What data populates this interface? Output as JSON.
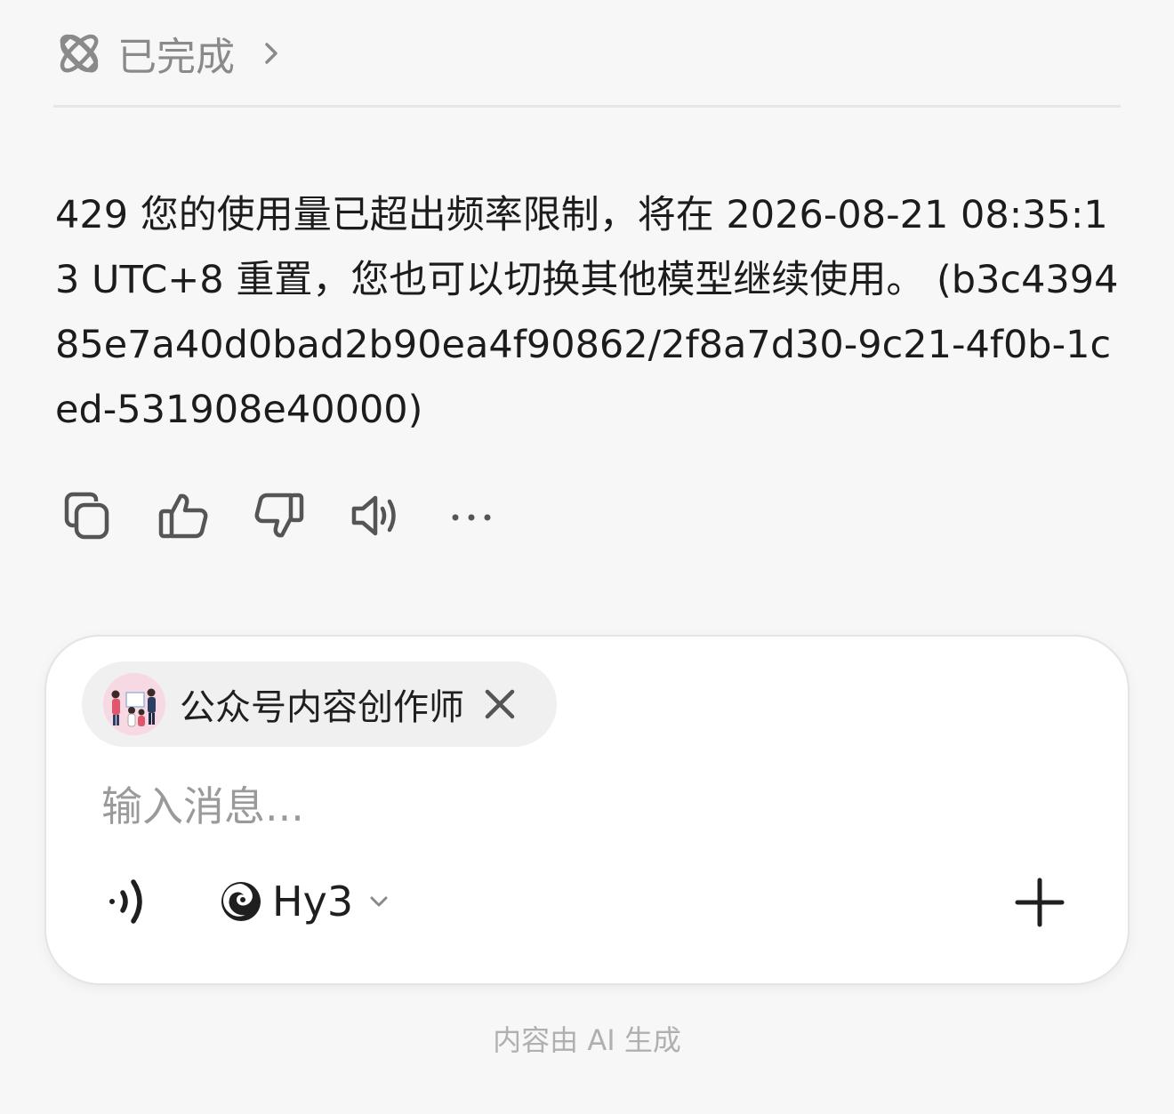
{
  "status": {
    "icon": "atom-icon",
    "label": "已完成",
    "chevron": "chevron-right-icon"
  },
  "message": {
    "text": "429 您的使用量已超出频率限制，将在 2026-08-21 08:35:13 UTC+8 重置，您也可以切换其他模型继续使用。 (b3c439485e7a40d0bad2b90ea4f90862/2f8a7d30-9c21-4f0b-1ced-531908e40000)"
  },
  "actions": [
    {
      "icon": "copy-icon"
    },
    {
      "icon": "thumbs-up-icon"
    },
    {
      "icon": "thumbs-down-icon"
    },
    {
      "icon": "speaker-icon"
    },
    {
      "icon": "more-icon"
    }
  ],
  "composer": {
    "agent_chip": {
      "label": "公众号内容创作师",
      "avatar": "agent-avatar",
      "close_icon": "close-icon"
    },
    "input": {
      "value": "",
      "placeholder": "输入消息..."
    },
    "voice_icon": "voice-wave-icon",
    "model": {
      "logo": "hunyuan-logo-icon",
      "name": "Hy3",
      "caret": "chevron-down-icon"
    },
    "plus_icon": "plus-icon"
  },
  "footer": {
    "disclaimer": "内容由 AI 生成"
  },
  "colors": {
    "background": "#f7f7f7",
    "card": "#ffffff",
    "text": "#1f1f1f",
    "muted": "#8a8a8a",
    "chip": "#f0f0f0"
  }
}
